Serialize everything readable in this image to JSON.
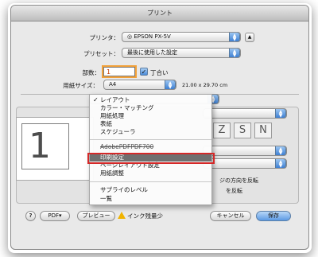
{
  "window": {
    "title": "プリント"
  },
  "printer": {
    "label": "プリンタ：",
    "value": "◎ EPSON PX-5V"
  },
  "preset": {
    "label": "プリセット：",
    "value": "最後に使用した設定"
  },
  "copies": {
    "label": "部数：",
    "value": "1",
    "collate_label": "丁合い"
  },
  "paper": {
    "label": "用紙サイズ：",
    "value": "A4",
    "dimensions": "21.00 x 29.70 cm"
  },
  "section_popup": {
    "value": ""
  },
  "preview": {
    "page_number": "1"
  },
  "layout_tiles": [
    "Z",
    "S",
    "N",
    "N"
  ],
  "behind_text": {
    "flip_label": "ジの方向を反転",
    "reverse_label": "を反転"
  },
  "menu": {
    "items": [
      {
        "label": "レイアウト",
        "checked": true
      },
      {
        "label": "カラー・マッチング"
      },
      {
        "label": "用紙処理"
      },
      {
        "label": "表紙"
      },
      {
        "label": "スケジューラ"
      },
      {
        "label": "AdobePDFPDF700"
      },
      {
        "label": "印刷設定"
      },
      {
        "label": "ページレイアウト設定"
      },
      {
        "label": "用紙調整"
      },
      {
        "label": "サプライのレベル"
      },
      {
        "label": "一覧"
      }
    ],
    "selected_index": 6
  },
  "footer": {
    "help": "?",
    "pdf": "PDF▾",
    "preview": "プレビュー",
    "ink_warning": "インク残量少",
    "cancel": "キャンセル",
    "save": "保存"
  },
  "colors": {
    "accent": "#3d7fd3",
    "highlight": "#d42828",
    "menu_selected": "#6f6f6f"
  }
}
